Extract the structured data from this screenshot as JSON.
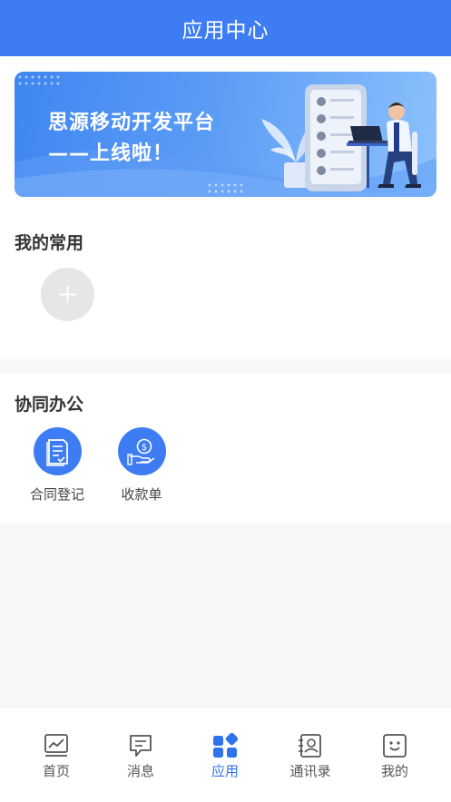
{
  "header": {
    "title": "应用中心"
  },
  "banner": {
    "line1": "思源移动开发平台",
    "line2": "——上线啦！"
  },
  "favorites": {
    "title": "我的常用",
    "add_icon": "plus-icon"
  },
  "collab": {
    "title": "协同办公",
    "apps": [
      {
        "label": "合同登记",
        "icon": "contract-document-icon"
      },
      {
        "label": "收款单",
        "icon": "payment-hand-coin-icon"
      }
    ]
  },
  "tabbar": {
    "tabs": [
      {
        "label": "首页",
        "icon": "home-chart-icon"
      },
      {
        "label": "消息",
        "icon": "message-icon"
      },
      {
        "label": "应用",
        "icon": "apps-grid-icon",
        "active": true
      },
      {
        "label": "通讯录",
        "icon": "contacts-icon"
      },
      {
        "label": "我的",
        "icon": "profile-smile-icon"
      }
    ]
  },
  "colors": {
    "primary": "#3d7cf2",
    "background": "#f7f7f7"
  }
}
